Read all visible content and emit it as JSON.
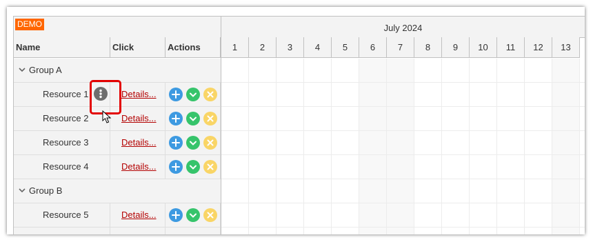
{
  "badge": "DEMO",
  "columns": {
    "name": "Name",
    "click": "Click",
    "actions": "Actions"
  },
  "timeline": {
    "month": "July 2024",
    "days": [
      "1",
      "2",
      "3",
      "4",
      "5",
      "6",
      "7",
      "8",
      "9",
      "10",
      "11",
      "12",
      "13"
    ]
  },
  "groups": [
    {
      "label": "Group A"
    },
    {
      "label": "Group B"
    }
  ],
  "resources": [
    {
      "name": "Resource 1",
      "link": "Details..."
    },
    {
      "name": "Resource 2",
      "link": "Details..."
    },
    {
      "name": "Resource 3",
      "link": "Details..."
    },
    {
      "name": "Resource 4",
      "link": "Details..."
    },
    {
      "name": "Resource 5",
      "link": "Details..."
    }
  ],
  "icons": {
    "add": "plus-icon",
    "confirm": "check-icon",
    "remove": "close-icon",
    "menu": "more-vertical-icon",
    "collapse": "chevron-down-icon"
  },
  "colors": {
    "add": "#3d9ae1",
    "confirm": "#36c46b",
    "remove": "#f9d566",
    "badge": "#ff6600",
    "link": "#b30000",
    "highlight": "#e30000"
  }
}
